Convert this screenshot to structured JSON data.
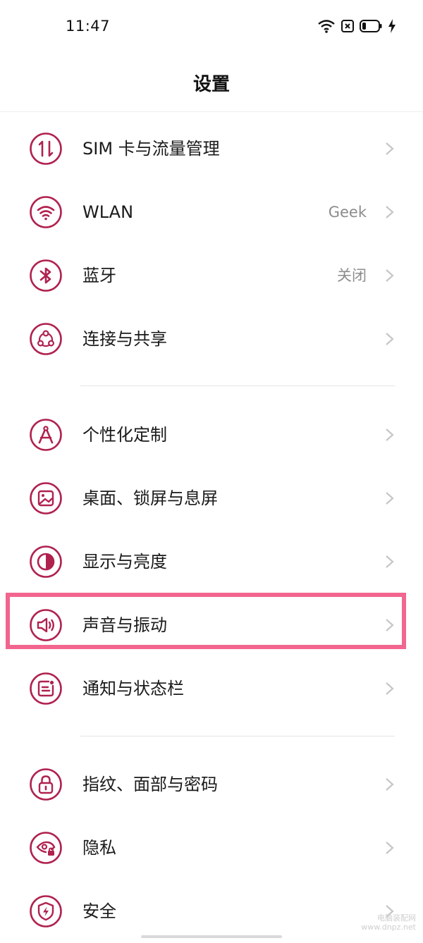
{
  "status_bar": {
    "time": "11:47",
    "icons": [
      "wifi-icon",
      "no-sim-icon",
      "battery-icon",
      "charging-icon"
    ]
  },
  "header": {
    "title": "设置"
  },
  "accent_color": "#b0224e",
  "highlight_color": "#f2658e",
  "groups": [
    {
      "items": [
        {
          "icon": "sim-data-icon",
          "label": "SIM 卡与流量管理",
          "value": ""
        },
        {
          "icon": "wifi-icon",
          "label": "WLAN",
          "value": "Geek"
        },
        {
          "icon": "bluetooth-icon",
          "label": "蓝牙",
          "value": "关闭"
        },
        {
          "icon": "connection-share-icon",
          "label": "连接与共享",
          "value": ""
        }
      ]
    },
    {
      "items": [
        {
          "icon": "compass-icon",
          "label": "个性化定制",
          "value": ""
        },
        {
          "icon": "wallpaper-icon",
          "label": "桌面、锁屏与息屏",
          "value": ""
        },
        {
          "icon": "display-brightness-icon",
          "label": "显示与亮度",
          "value": ""
        },
        {
          "icon": "speaker-icon",
          "label": "声音与振动",
          "value": "",
          "highlighted": true
        },
        {
          "icon": "notification-icon",
          "label": "通知与状态栏",
          "value": ""
        }
      ]
    },
    {
      "items": [
        {
          "icon": "lock-icon",
          "label": "指纹、面部与密码",
          "value": ""
        },
        {
          "icon": "privacy-eye-icon",
          "label": "隐私",
          "value": ""
        },
        {
          "icon": "shield-icon",
          "label": "安全",
          "value": ""
        }
      ]
    }
  ],
  "watermark": {
    "line1": "电脑装配网",
    "line2": "www.dnpz.net"
  }
}
